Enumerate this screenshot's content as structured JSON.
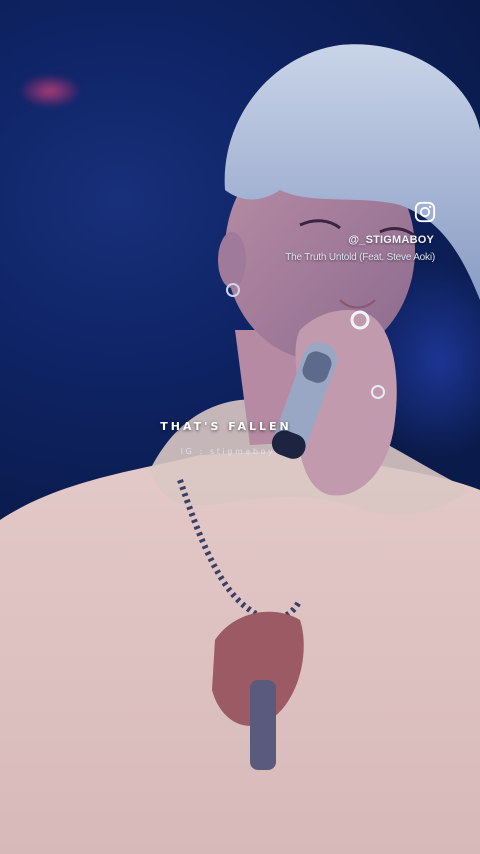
{
  "overlay": {
    "icon": "instagram-icon",
    "handle": "@_STIGMABOY",
    "song_title": "The Truth Untold (Feat. Steve Aoki)",
    "lyric": "THAT'S FALLEN",
    "watermark": "IG : stigmaboy"
  },
  "colors": {
    "background": "#0a1a4a",
    "stage_blue": "#0f2466",
    "text": "#ffffff"
  }
}
